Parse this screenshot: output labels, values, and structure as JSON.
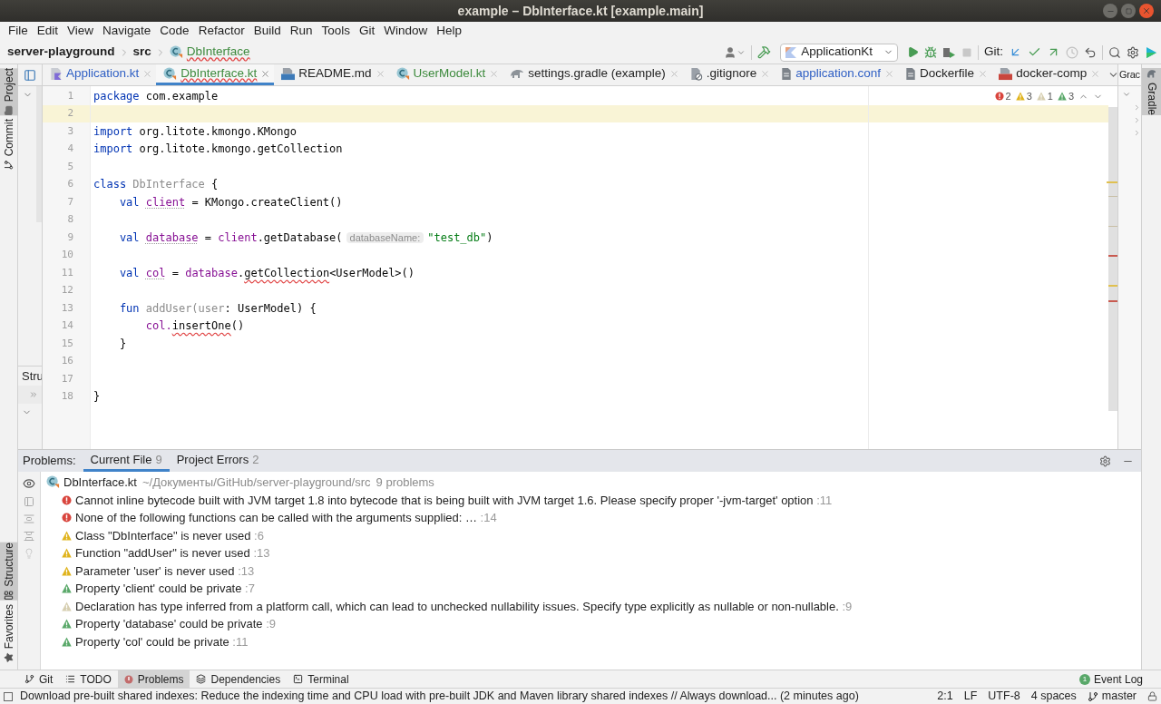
{
  "window": {
    "title": "example – DbInterface.kt [example.main]"
  },
  "menu": [
    "File",
    "Edit",
    "View",
    "Navigate",
    "Code",
    "Refactor",
    "Build",
    "Run",
    "Tools",
    "Git",
    "Window",
    "Help"
  ],
  "breadcrumbs": [
    {
      "label": "server-playground",
      "kind": "folder"
    },
    {
      "label": "src",
      "kind": "folder"
    },
    {
      "label": "DbInterface",
      "kind": "class"
    }
  ],
  "toolbar": {
    "run_config": "ApplicationKt",
    "git_label": "Git:",
    "buttons": [
      {
        "kind": "run",
        "disabled": false
      },
      {
        "kind": "debug",
        "disabled": false
      },
      {
        "kind": "coverage",
        "disabled": false
      },
      {
        "kind": "stop",
        "disabled": true
      }
    ],
    "git_buttons": [
      {
        "kind": "update",
        "disabled": false
      },
      {
        "kind": "commit",
        "disabled": false
      },
      {
        "kind": "push",
        "disabled": false
      },
      {
        "kind": "history",
        "disabled": true
      },
      {
        "kind": "rollback",
        "disabled": false
      }
    ]
  },
  "left_strip": {
    "top": [
      {
        "label": "Project",
        "kind": "project",
        "selected": true
      },
      {
        "label": "Commit",
        "kind": "commit",
        "selected": false
      }
    ],
    "bottom": [
      {
        "label": "Structure",
        "kind": "structure",
        "selected": true
      },
      {
        "label": "Favorites",
        "kind": "favorites",
        "selected": false
      }
    ]
  },
  "structure_panel": {
    "label": "Stru"
  },
  "editor_tabs": [
    {
      "label": "Application.kt",
      "kind": "kotlin-file",
      "color": "#2f5fc4",
      "selected": false,
      "error": false
    },
    {
      "label": "DbInterface.kt",
      "kind": "kotlin-class",
      "color": "#3d8a3d",
      "selected": true,
      "error": true
    },
    {
      "label": "README.md",
      "kind": "markdown",
      "color": "#1f1f1f",
      "selected": false,
      "error": false
    },
    {
      "label": "UserModel.kt",
      "kind": "kotlin-class",
      "color": "#3d8a3d",
      "selected": false,
      "error": false
    },
    {
      "label": "settings.gradle (example)",
      "kind": "gradle",
      "color": "#1f1f1f",
      "selected": false,
      "error": false
    },
    {
      "label": ".gitignore",
      "kind": "gitignore",
      "color": "#1f1f1f",
      "selected": false,
      "error": false
    },
    {
      "label": "application.conf",
      "kind": "file",
      "color": "#2f5fc4",
      "selected": false,
      "error": false
    },
    {
      "label": "Dockerfile",
      "kind": "file",
      "color": "#1f1f1f",
      "selected": false,
      "error": false
    },
    {
      "label": "docker-comp",
      "kind": "yaml",
      "color": "#1f1f1f",
      "selected": false,
      "error": false
    }
  ],
  "right_panel": {
    "tab": "Grac"
  },
  "right_strip": [
    {
      "label": "Gradle",
      "selected": true
    }
  ],
  "inspections": [
    {
      "kind": "error",
      "count": "2"
    },
    {
      "kind": "warning",
      "count": "3"
    },
    {
      "kind": "weak_warning",
      "count": "1"
    },
    {
      "kind": "info",
      "count": "3"
    }
  ],
  "code": [
    {
      "number": "1",
      "current": false,
      "tokens": [
        {
          "text": "package",
          "kind": "keyword"
        },
        {
          "text": " com.example",
          "kind": "plain"
        }
      ]
    },
    {
      "number": "2",
      "current": true
    },
    {
      "number": "3",
      "current": false,
      "tokens": [
        {
          "text": "import",
          "kind": "keyword"
        },
        {
          "text": " org.litote.kmongo.KMongo",
          "kind": "plain"
        }
      ]
    },
    {
      "number": "4",
      "current": false,
      "tokens": [
        {
          "text": "import",
          "kind": "keyword"
        },
        {
          "text": " org.litote.kmongo.getCollection",
          "kind": "plain"
        }
      ]
    },
    {
      "number": "5",
      "current": false
    },
    {
      "number": "6",
      "current": false,
      "tokens": [
        {
          "text": "class",
          "kind": "keyword"
        },
        {
          "text": " DbInterface",
          "kind": "unused"
        },
        {
          "text": " {",
          "kind": "plain"
        }
      ]
    },
    {
      "number": "7",
      "current": false,
      "tokens": [
        {
          "text": "    val ",
          "kind": "keyword"
        },
        {
          "text": "client",
          "kind": "property_flagged"
        },
        {
          "text": " = KMongo.createClient()",
          "kind": "plain"
        }
      ]
    },
    {
      "number": "8",
      "current": false
    },
    {
      "number": "9",
      "current": false,
      "tokens": [
        {
          "text": "    val ",
          "kind": "keyword"
        },
        {
          "text": "database",
          "kind": "property_flagged"
        },
        {
          "text": " = ",
          "kind": "plain"
        },
        {
          "text": "client",
          "kind": "property"
        },
        {
          "text": ".getDatabase(",
          "kind": "plain"
        },
        {
          "text": "databaseName:",
          "kind": "hint"
        },
        {
          "text": "\"test_db\"",
          "kind": "string"
        },
        {
          "text": ")",
          "kind": "plain"
        }
      ]
    },
    {
      "number": "10",
      "current": false
    },
    {
      "number": "11",
      "current": false,
      "tokens": [
        {
          "text": "    val ",
          "kind": "keyword"
        },
        {
          "text": "col",
          "kind": "property_flagged"
        },
        {
          "text": " = ",
          "kind": "plain"
        },
        {
          "text": "database",
          "kind": "property"
        },
        {
          "text": ".",
          "kind": "plain"
        },
        {
          "text": "getCollection",
          "kind": "error"
        },
        {
          "text": "<UserModel>()",
          "kind": "plain"
        }
      ]
    },
    {
      "number": "12",
      "current": false
    },
    {
      "number": "13",
      "current": false,
      "tokens": [
        {
          "text": "    fun ",
          "kind": "keyword"
        },
        {
          "text": "addUser(user",
          "kind": "unused"
        },
        {
          "text": ": UserModel) {",
          "kind": "plain"
        }
      ]
    },
    {
      "number": "14",
      "current": false,
      "tokens": [
        {
          "text": "        col.",
          "kind": "property"
        },
        {
          "text": "insertOne",
          "kind": "error"
        },
        {
          "text": "()",
          "kind": "plain"
        }
      ]
    },
    {
      "number": "15",
      "current": false,
      "tokens": [
        {
          "text": "    }",
          "kind": "plain"
        }
      ]
    },
    {
      "number": "16",
      "current": false
    },
    {
      "number": "17",
      "current": false
    },
    {
      "number": "18",
      "current": false,
      "tokens": [
        {
          "text": "}",
          "kind": "plain"
        }
      ]
    }
  ],
  "problems": {
    "label": "Problems:",
    "tabs": [
      {
        "label": "Current File",
        "count": "9",
        "selected": true
      },
      {
        "label": "Project Errors",
        "count": "2",
        "selected": false
      }
    ],
    "file": {
      "name": "DbInterface.kt",
      "path": "~/Документы/GitHub/server-playground/src",
      "summary": "9 problems"
    },
    "items": [
      {
        "kind": "error",
        "text": "Cannot inline bytecode built with JVM target 1.8 into bytecode that is being built with JVM target 1.6. Please specify proper '-jvm-target' option",
        "line": ":11"
      },
      {
        "kind": "error",
        "text": "None of the following functions can be called with the arguments supplied: …",
        "line": ":14"
      },
      {
        "kind": "warning",
        "text": "Class \"DbInterface\" is never used",
        "line": ":6"
      },
      {
        "kind": "warning",
        "text": "Function \"addUser\" is never used",
        "line": ":13"
      },
      {
        "kind": "warning",
        "text": "Parameter 'user' is never used",
        "line": ":13"
      },
      {
        "kind": "info",
        "text": "Property 'client' could be private",
        "line": ":7"
      },
      {
        "kind": "weak_warning",
        "text": "Declaration has type inferred from a platform call, which can lead to unchecked nullability issues. Specify type explicitly as nullable or non-nullable.",
        "line": ":9"
      },
      {
        "kind": "info",
        "text": "Property 'database' could be private",
        "line": ":9"
      },
      {
        "kind": "info",
        "text": "Property 'col' could be private",
        "line": ":11"
      }
    ]
  },
  "tool_tabs": [
    {
      "label": "Git",
      "kind": "git",
      "selected": false
    },
    {
      "label": "TODO",
      "kind": "todo",
      "selected": false
    },
    {
      "label": "Problems",
      "kind": "problems",
      "selected": true
    },
    {
      "label": "Dependencies",
      "kind": "dependencies",
      "selected": false
    },
    {
      "label": "Terminal",
      "kind": "terminal",
      "selected": false
    }
  ],
  "event_log": {
    "label": "Event Log",
    "badge": "1"
  },
  "status": {
    "message": "Download pre-built shared indexes: Reduce the indexing time and CPU load with pre-built JDK and Maven library shared indexes // Always download... (2 minutes ago)",
    "position": "2:1",
    "line_ending": "LF",
    "encoding": "UTF-8",
    "indent": "4 spaces",
    "branch": "master"
  }
}
